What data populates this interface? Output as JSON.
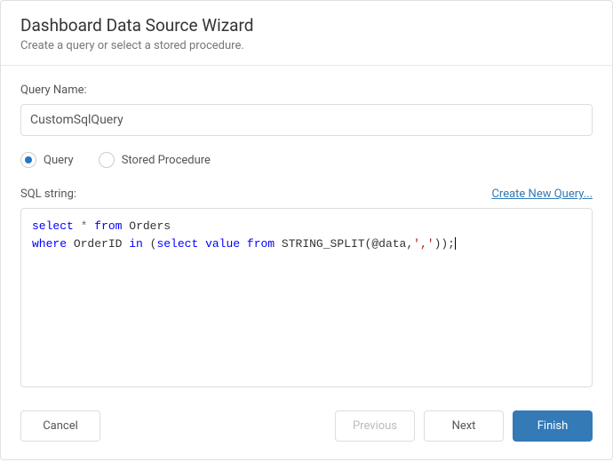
{
  "header": {
    "title": "Dashboard Data Source Wizard",
    "subtitle": "Create a query or select a stored procedure."
  },
  "queryName": {
    "label": "Query Name:",
    "value": "CustomSqlQuery"
  },
  "mode": {
    "options": [
      {
        "label": "Query",
        "selected": true
      },
      {
        "label": "Stored Procedure",
        "selected": false
      }
    ]
  },
  "sql": {
    "label": "SQL string:",
    "createLink": "Create New Query...",
    "tokens": [
      {
        "t": "select",
        "c": "kw"
      },
      {
        "t": " "
      },
      {
        "t": "*",
        "c": "op"
      },
      {
        "t": " "
      },
      {
        "t": "from",
        "c": "kw"
      },
      {
        "t": " Orders\n"
      },
      {
        "t": "where",
        "c": "kw"
      },
      {
        "t": " OrderID "
      },
      {
        "t": "in",
        "c": "kw"
      },
      {
        "t": " ("
      },
      {
        "t": "select",
        "c": "kw"
      },
      {
        "t": " "
      },
      {
        "t": "value",
        "c": "kw"
      },
      {
        "t": " "
      },
      {
        "t": "from",
        "c": "kw"
      },
      {
        "t": " STRING_SPLIT(@data,"
      },
      {
        "t": "','",
        "c": "str"
      },
      {
        "t": "));"
      }
    ]
  },
  "footer": {
    "cancel": "Cancel",
    "previous": "Previous",
    "next": "Next",
    "finish": "Finish"
  }
}
